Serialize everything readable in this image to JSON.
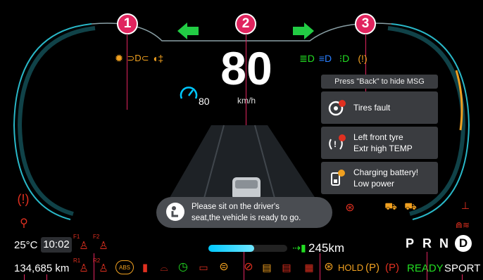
{
  "colors": {
    "accent": "#00c8ff",
    "callout": "#e0245e",
    "warn_red": "#e03020",
    "warn_orange": "#f0a020",
    "ok_green": "#22dd22",
    "info_blue": "#2a7fff"
  },
  "callouts": [
    "1",
    "2",
    "3"
  ],
  "speed": {
    "value": "80",
    "unit": "km/h"
  },
  "cruise": {
    "value": "80"
  },
  "messages": {
    "header": "Press \"Back\" to hide MSG",
    "items": [
      {
        "line1": "Tires fault",
        "line2": "",
        "icon": "steering-fault-icon"
      },
      {
        "line1": "Left front tyre",
        "line2": "Extr high TEMP",
        "icon": "tire-pressure-icon"
      },
      {
        "line1": "Charging battery!",
        "line2": "Low power",
        "icon": "battery-charging-icon"
      }
    ]
  },
  "notice": {
    "line1": "Please sit on the driver's",
    "line2": "seat,the vehicle is ready to go."
  },
  "status": {
    "temperature": "25°C",
    "time": "10:02",
    "odometer": "134,685 km",
    "range": "245km",
    "range_fill": 0.58,
    "hold": "HOLD",
    "ready": "READY",
    "mode": "SPORT"
  },
  "gear": {
    "p": "P",
    "r": "R",
    "n": "N",
    "d": "D",
    "selected": "D"
  },
  "seat_labels": {
    "f1": "F1",
    "f2": "F2",
    "r1": "R1",
    "r2": "R2"
  },
  "indicator_icons": [
    "fog-light-icon",
    "parking-light-icon",
    "rear-fog-icon",
    "high-beam-icon",
    "low-beam-icon",
    "auto-beam-icon",
    "brake-fault-icon"
  ],
  "bottom_icons": [
    "abs-icon",
    "door-icon",
    "car-icon",
    "clock-icon",
    "battery-icon",
    "oil-icon",
    "ev-icon",
    "battery-warn-icon",
    "battery-charge-icon",
    "battery-temp-icon",
    "steering-icon",
    "parking-brake-icon",
    "parking-icon"
  ]
}
